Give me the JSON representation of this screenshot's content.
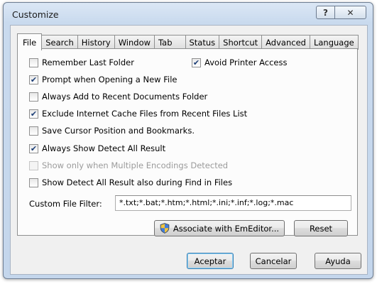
{
  "window": {
    "title": "Customize",
    "help_label": "?",
    "close_label": "✕"
  },
  "tabs": [
    {
      "label": "File",
      "active": true
    },
    {
      "label": "Search"
    },
    {
      "label": "History"
    },
    {
      "label": "Window"
    },
    {
      "label": "Tab"
    },
    {
      "label": "Status"
    },
    {
      "label": "Shortcut"
    },
    {
      "label": "Advanced"
    },
    {
      "label": "Language"
    }
  ],
  "file": {
    "remember_last_folder": {
      "label": "Remember Last Folder",
      "checked": false
    },
    "avoid_printer_access": {
      "label": "Avoid Printer Access",
      "checked": true
    },
    "prompt_new_file": {
      "label": "Prompt when Opening a New File",
      "checked": true
    },
    "always_add_recent": {
      "label": "Always Add to Recent Documents Folder",
      "checked": false
    },
    "exclude_cache": {
      "label": "Exclude Internet Cache Files from Recent Files List",
      "checked": true
    },
    "save_cursor": {
      "label": "Save Cursor Position and Bookmarks.",
      "checked": false
    },
    "show_detect_all": {
      "label": "Always Show Detect All Result",
      "checked": true
    },
    "show_only_multiple": {
      "label": "Show only when Multiple Encodings Detected",
      "checked": false,
      "disabled": true
    },
    "show_detect_find": {
      "label": "Show Detect All Result also during Find in Files",
      "checked": false
    },
    "custom_filter_label": "Custom File Filter:",
    "custom_filter_value": "*.txt;*.bat;*.htm;*.html;*.ini;*.inf;*.log;*.mac",
    "associate_label": "Associate with EmEditor...",
    "reset_label": "Reset"
  },
  "footer": {
    "ok_label": "Aceptar",
    "cancel_label": "Cancelar",
    "help_label": "Ayuda"
  }
}
